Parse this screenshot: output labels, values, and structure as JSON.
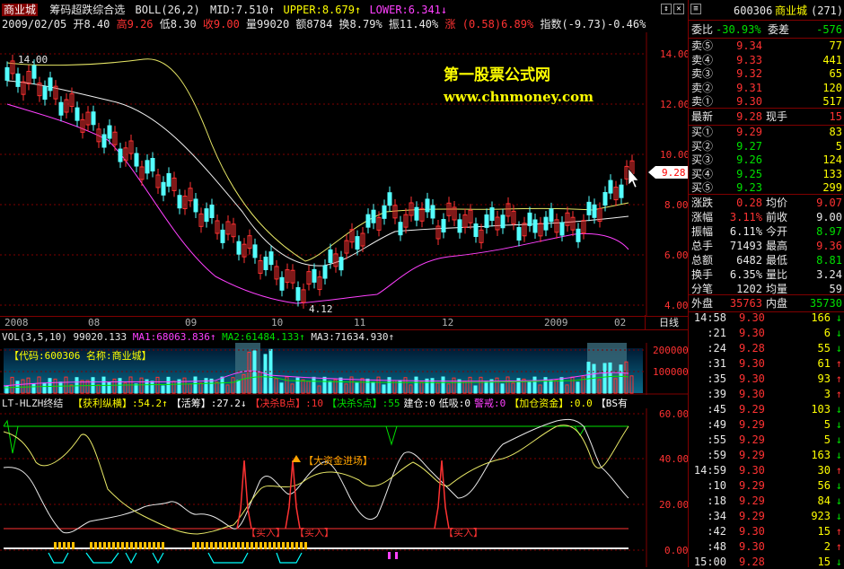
{
  "header": {
    "stock_name": "商业城",
    "indicator": "筹码超跌综合选",
    "boll_label": "BOLL(26,2)",
    "mid": "MID:7.510",
    "upper": "UPPER:8.679",
    "lower": "LOWER:6.341",
    "up_arrow": "↑",
    "down_arrow": "↓",
    "date": "2009/02/05",
    "open": "开8.40",
    "high": "高9.26",
    "low": "低8.30",
    "close": "收9.00",
    "vol": "量99020",
    "amount": "额8784",
    "turnover": "换8.79%",
    "amplitude": "振11.40%",
    "change": "涨 (0.58)6.89%",
    "index": "指数(-9.73)-0.46%"
  },
  "watermark": {
    "line1": "第一股票公式网",
    "line2": "www.chnmoney.com"
  },
  "price_axis": {
    "ticks": [
      "14.00",
      "12.00",
      "10.00",
      "8.00",
      "6.00",
      "4.00"
    ],
    "current": "9.28"
  },
  "price_annotations": {
    "high_label": "14.00",
    "low_label": "4.12"
  },
  "time_axis": {
    "labels": [
      "2008",
      "08",
      "09",
      "10",
      "11",
      "12",
      "2009",
      "02"
    ],
    "period": "日线"
  },
  "volume": {
    "title": "VOL(3,5,10)",
    "value": "99020.133",
    "ma1": "MA1:68063.836",
    "ma2": "MA2:61484.133",
    "ma3": "MA3:71634.930",
    "code_label": "【代码:600306 名称:商业城】",
    "axis": [
      "200000",
      "100000"
    ]
  },
  "indicator_panel": {
    "name": "LT-HLZH终结",
    "items": [
      {
        "label": "【获利纵横】",
        "value": ":54.2",
        "arrow": "↑",
        "color": "#ffff00"
      },
      {
        "label": "【活筹】",
        "value": ":27.2",
        "arrow": "↓",
        "color": "#ffffff"
      },
      {
        "label": "【决杀B点】",
        "value": ":10",
        "arrow": "",
        "color": "#ff3232"
      },
      {
        "label": "【决杀S点】",
        "value": ":55",
        "arrow": "",
        "color": "#00e000"
      },
      {
        "label": "建仓",
        "value": ":0",
        "arrow": "",
        "color": "#ffffff"
      },
      {
        "label": "低吸",
        "value": ":0",
        "arrow": "",
        "color": "#ffffff"
      },
      {
        "label": "警戒",
        "value": ":0",
        "arrow": "",
        "color": "#ff40ff"
      },
      {
        "label": "【加仓资金】",
        "value": ":0.0",
        "arrow": "",
        "color": "#ffff00"
      },
      {
        "label": "【BS有",
        "value": "",
        "arrow": "",
        "color": "#ffffff"
      }
    ],
    "axis": [
      "60.00",
      "40.00",
      "20.00",
      "0.00"
    ],
    "big_money": "【大资金进场】",
    "buy_label": "【买入】"
  },
  "quote": {
    "code": "600306",
    "name": "商业城",
    "count": "(271)",
    "weibi_label": "委比",
    "weibi": "-30.93%",
    "weicha_label": "委差",
    "weicha": "-576",
    "sells": [
      {
        "label": "卖⑤",
        "price": "9.34",
        "vol": "77"
      },
      {
        "label": "卖④",
        "price": "9.33",
        "vol": "441"
      },
      {
        "label": "卖③",
        "price": "9.32",
        "vol": "65"
      },
      {
        "label": "卖②",
        "price": "9.31",
        "vol": "120"
      },
      {
        "label": "卖①",
        "price": "9.30",
        "vol": "517"
      }
    ],
    "latest_label": "最新",
    "latest": "9.28",
    "xianshou_label": "现手",
    "xianshou": "15",
    "buys": [
      {
        "label": "买①",
        "price": "9.29",
        "vol": "83"
      },
      {
        "label": "买②",
        "price": "9.27",
        "vol": "5"
      },
      {
        "label": "买③",
        "price": "9.26",
        "vol": "124"
      },
      {
        "label": "买④",
        "price": "9.25",
        "vol": "133"
      },
      {
        "label": "买⑤",
        "price": "9.23",
        "vol": "299"
      }
    ],
    "stats": [
      {
        "l1": "涨跌",
        "v1": "0.28",
        "l2": "均价",
        "v2": "9.07",
        "c1": "#ff3232",
        "c2": "#ff3232"
      },
      {
        "l1": "涨幅",
        "v1": "3.11%",
        "l2": "前收",
        "v2": "9.00",
        "c1": "#ff3232",
        "c2": "#e8e8e8"
      },
      {
        "l1": "振幅",
        "v1": "6.11%",
        "l2": "今开",
        "v2": "8.97",
        "c1": "#e8e8e8",
        "c2": "#00e000"
      },
      {
        "l1": "总手",
        "v1": "71493",
        "l2": "最高",
        "v2": "9.36",
        "c1": "#e8e8e8",
        "c2": "#ff3232"
      },
      {
        "l1": "总额",
        "v1": "6482",
        "l2": "最低",
        "v2": "8.81",
        "c1": "#e8e8e8",
        "c2": "#00e000"
      },
      {
        "l1": "换手",
        "v1": "6.35%",
        "l2": "量比",
        "v2": "3.24",
        "c1": "#e8e8e8",
        "c2": "#e8e8e8"
      },
      {
        "l1": "分笔",
        "v1": "1202",
        "l2": "均量",
        "v2": "59",
        "c1": "#e8e8e8",
        "c2": "#e8e8e8"
      }
    ],
    "outer_label": "外盘",
    "outer": "35763",
    "inner_label": "内盘",
    "inner": "35730"
  },
  "ticks": [
    {
      "time": "14:58",
      "price": "9.30",
      "vol": "166",
      "dir": "↓",
      "pc": "#ff3232",
      "dc": "#00e000"
    },
    {
      "time": ":21",
      "price": "9.30",
      "vol": "6",
      "dir": "↓",
      "pc": "#ff3232",
      "dc": "#00e000"
    },
    {
      "time": ":24",
      "price": "9.28",
      "vol": "55",
      "dir": "↓",
      "pc": "#ff3232",
      "dc": "#00e000"
    },
    {
      "time": ":31",
      "price": "9.30",
      "vol": "61",
      "dir": "↑",
      "pc": "#ff3232",
      "dc": "#ff3232"
    },
    {
      "time": ":35",
      "price": "9.30",
      "vol": "93",
      "dir": "↑",
      "pc": "#ff3232",
      "dc": "#ff3232"
    },
    {
      "time": ":39",
      "price": "9.30",
      "vol": "3",
      "dir": "↑",
      "pc": "#ff3232",
      "dc": "#ff3232"
    },
    {
      "time": ":45",
      "price": "9.29",
      "vol": "103",
      "dir": "↓",
      "pc": "#ff3232",
      "dc": "#00e000"
    },
    {
      "time": ":49",
      "price": "9.29",
      "vol": "5",
      "dir": "↓",
      "pc": "#ff3232",
      "dc": "#00e000"
    },
    {
      "time": ":55",
      "price": "9.29",
      "vol": "5",
      "dir": "↓",
      "pc": "#ff3232",
      "dc": "#00e000"
    },
    {
      "time": ":59",
      "price": "9.29",
      "vol": "163",
      "dir": "↓",
      "pc": "#ff3232",
      "dc": "#00e000"
    },
    {
      "time": "14:59",
      "price": "9.30",
      "vol": "30",
      "dir": "↑",
      "pc": "#ff3232",
      "dc": "#ff3232"
    },
    {
      "time": ":10",
      "price": "9.29",
      "vol": "56",
      "dir": "↓",
      "pc": "#ff3232",
      "dc": "#00e000"
    },
    {
      "time": ":18",
      "price": "9.29",
      "vol": "84",
      "dir": "↓",
      "pc": "#ff3232",
      "dc": "#00e000"
    },
    {
      "time": ":34",
      "price": "9.29",
      "vol": "923",
      "dir": "↓",
      "pc": "#ff3232",
      "dc": "#00e000"
    },
    {
      "time": ":42",
      "price": "9.30",
      "vol": "15",
      "dir": "↑",
      "pc": "#ff3232",
      "dc": "#ff3232"
    },
    {
      "time": ":48",
      "price": "9.30",
      "vol": "2",
      "dir": "↑",
      "pc": "#ff3232",
      "dc": "#ff3232"
    },
    {
      "time": "15:00",
      "price": "9.28",
      "vol": "15",
      "dir": "↓",
      "pc": "#ff3232",
      "dc": "#00e000"
    }
  ]
}
